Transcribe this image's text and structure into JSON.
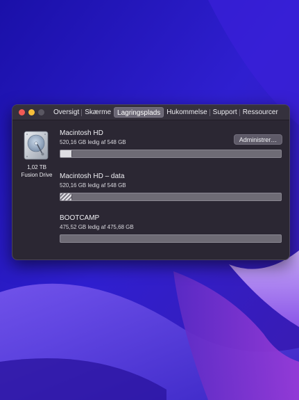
{
  "window": {
    "tabs": [
      {
        "label": "Oversigt",
        "active": false
      },
      {
        "label": "Skærme",
        "active": false
      },
      {
        "label": "Lagringsplads",
        "active": true
      },
      {
        "label": "Hukommelse",
        "active": false
      },
      {
        "label": "Support",
        "active": false
      },
      {
        "label": "Ressourcer",
        "active": false
      }
    ]
  },
  "drive": {
    "icon": "hard-drive-icon",
    "capacity": "1,02 TB",
    "type": "Fusion Drive"
  },
  "manage_button": "Administrer…",
  "volumes": [
    {
      "name": "Macintosh HD",
      "usage": "520,16 GB ledig af 548 GB",
      "used_fraction": 0.05,
      "pattern": "solid"
    },
    {
      "name": "Macintosh HD – data",
      "usage": "520,16 GB ledig af 548 GB",
      "used_fraction": 0.05,
      "pattern": "hatched"
    },
    {
      "name": "BOOTCAMP",
      "usage": "475,52 GB ledig af 475,68 GB",
      "used_fraction": 0.0,
      "pattern": "solid"
    }
  ],
  "colors": {
    "close": "#f25a55",
    "minimize": "#f7be3a",
    "window_bg": "#2b2733",
    "bar_free": "#6e6b75",
    "bar_used": "#dedde2"
  }
}
